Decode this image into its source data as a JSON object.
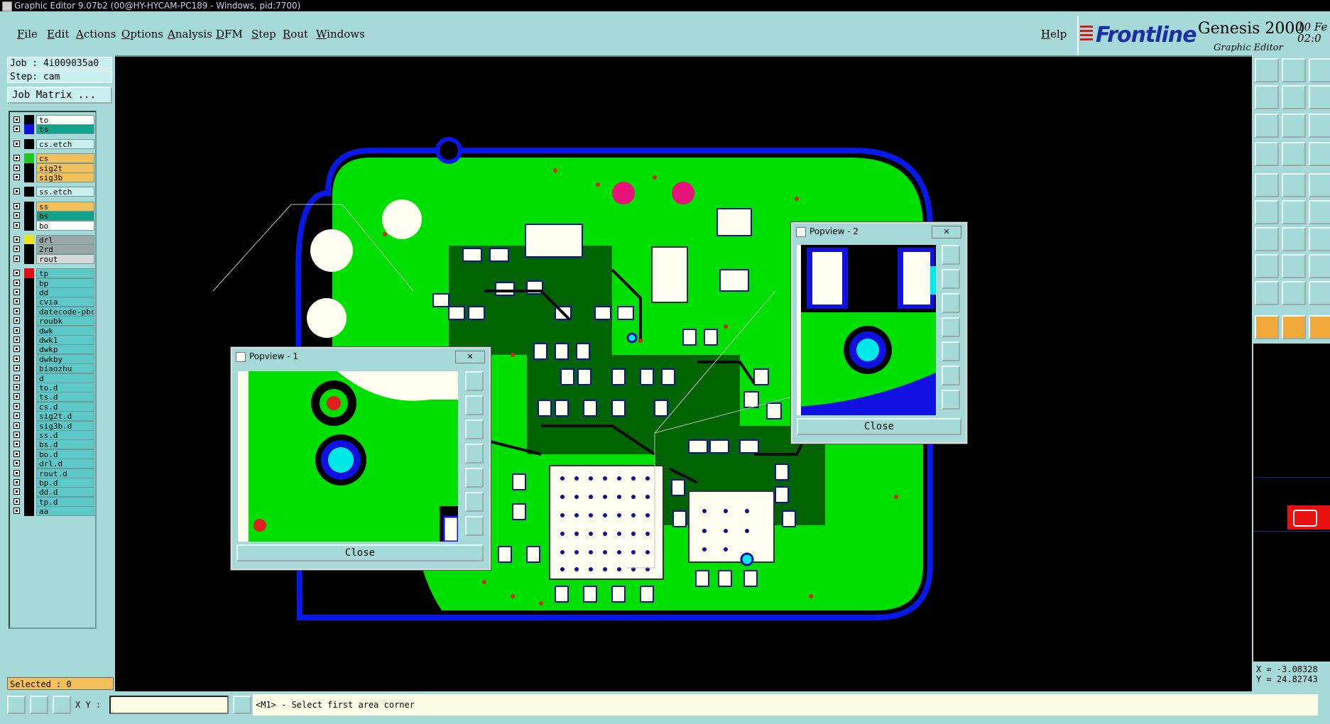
{
  "window": {
    "title": "Graphic Editor 9.07b2 (00@HY-HYCAM-PC189 - Windows, pid:7700)"
  },
  "menu": {
    "items": [
      "File",
      "Edit",
      "Actions",
      "Options",
      "Analysis",
      "DFM",
      "Step",
      "Rout",
      "Windows"
    ],
    "help": "Help"
  },
  "brand": {
    "logo": "Frontline",
    "product": "Genesis 2000",
    "subtitle": "Graphic Editor",
    "date": "10 Fe",
    "time": "02:0"
  },
  "job": {
    "job_label": "Job : 4i009035a0",
    "step_label": "Step: cam",
    "matrix_button": "Job Matrix ..."
  },
  "layers": [
    {
      "name": "to",
      "color": "#000000",
      "bg": "#ffffff",
      "group": 1
    },
    {
      "name": "ts",
      "color": "#1010e0",
      "bg": "#12a38a",
      "group": 1
    },
    {
      "name": "cs.etch",
      "color": "#000000",
      "bg": "#c9f0ee",
      "group": 2
    },
    {
      "name": "cs",
      "color": "#22c822",
      "bg": "#f4c05a",
      "group": 3
    },
    {
      "name": "sig2t",
      "color": "#000000",
      "bg": "#f4c05a",
      "group": 3
    },
    {
      "name": "sig3b",
      "color": "#000000",
      "bg": "#f4c05a",
      "group": 3
    },
    {
      "name": "ss.etch",
      "color": "#000000",
      "bg": "#c9f0ee",
      "group": 4
    },
    {
      "name": "ss",
      "color": "#000000",
      "bg": "#f4c05a",
      "group": 5
    },
    {
      "name": "bs",
      "color": "#000000",
      "bg": "#12a38a",
      "group": 5
    },
    {
      "name": "bo",
      "color": "#000000",
      "bg": "#ffffff",
      "group": 5
    },
    {
      "name": "drl",
      "color": "#f0e020",
      "bg": "#9aa8a8",
      "group": 6
    },
    {
      "name": "2rd",
      "color": "#000000",
      "bg": "#9aa8a8",
      "group": 6
    },
    {
      "name": "rout",
      "color": "#000000",
      "bg": "#d8d8d8",
      "group": 6
    },
    {
      "name": "tp",
      "color": "#e01010",
      "bg": "#5cc8c8",
      "group": 7
    },
    {
      "name": "bp",
      "color": "#000000",
      "bg": "#5cc8c8",
      "group": 7
    },
    {
      "name": "dd",
      "color": "#000000",
      "bg": "#5cc8c8",
      "group": 7
    },
    {
      "name": "cvia",
      "color": "#000000",
      "bg": "#5cc8c8",
      "group": 7
    },
    {
      "name": "datecode-pbc",
      "color": "#000000",
      "bg": "#5cc8c8",
      "group": 7
    },
    {
      "name": "roubk",
      "color": "#000000",
      "bg": "#5cc8c8",
      "group": 7
    },
    {
      "name": "dwk",
      "color": "#000000",
      "bg": "#5cc8c8",
      "group": 7
    },
    {
      "name": "dwk1",
      "color": "#000000",
      "bg": "#5cc8c8",
      "group": 7
    },
    {
      "name": "dwkp",
      "color": "#000000",
      "bg": "#5cc8c8",
      "group": 7
    },
    {
      "name": "dwkby",
      "color": "#000000",
      "bg": "#5cc8c8",
      "group": 7
    },
    {
      "name": "biaozhu",
      "color": "#000000",
      "bg": "#5cc8c8",
      "group": 7
    },
    {
      "name": "d",
      "color": "#000000",
      "bg": "#5cc8c8",
      "group": 7
    },
    {
      "name": "to.d",
      "color": "#000000",
      "bg": "#5cc8c8",
      "group": 7
    },
    {
      "name": "ts.d",
      "color": "#000000",
      "bg": "#5cc8c8",
      "group": 7
    },
    {
      "name": "cs.d",
      "color": "#000000",
      "bg": "#5cc8c8",
      "group": 7
    },
    {
      "name": "sig2t.d",
      "color": "#000000",
      "bg": "#5cc8c8",
      "group": 7
    },
    {
      "name": "sig3b.d",
      "color": "#000000",
      "bg": "#5cc8c8",
      "group": 7
    },
    {
      "name": "ss.d",
      "color": "#000000",
      "bg": "#5cc8c8",
      "group": 7
    },
    {
      "name": "bs.d",
      "color": "#000000",
      "bg": "#5cc8c8",
      "group": 7
    },
    {
      "name": "bo.d",
      "color": "#000000",
      "bg": "#5cc8c8",
      "group": 7
    },
    {
      "name": "drl.d",
      "color": "#000000",
      "bg": "#5cc8c8",
      "group": 7
    },
    {
      "name": "rout.d",
      "color": "#000000",
      "bg": "#5cc8c8",
      "group": 7
    },
    {
      "name": "bp.d",
      "color": "#000000",
      "bg": "#5cc8c8",
      "group": 7
    },
    {
      "name": "dd.d",
      "color": "#000000",
      "bg": "#5cc8c8",
      "group": 7
    },
    {
      "name": "tp.d",
      "color": "#000000",
      "bg": "#5cc8c8",
      "group": 7
    },
    {
      "name": "aa",
      "color": "#000000",
      "bg": "#5cc8c8",
      "group": 7
    }
  ],
  "status": {
    "selected": "Selected : 0",
    "xy_label": "X Y :",
    "prompt": "<M1> - Select first area corner"
  },
  "coords": {
    "x": "X = -3.08328",
    "y": "Y = 24.82743"
  },
  "popup1": {
    "title": "Popview - 1",
    "close": "Close"
  },
  "popup2": {
    "title": "Popview - 2",
    "close": "Close"
  },
  "colors": {
    "panel": "#a6dad8",
    "board": "#00e000",
    "outline": "#0818e8",
    "pad": "#fffef0",
    "drill": "#e8127a"
  }
}
